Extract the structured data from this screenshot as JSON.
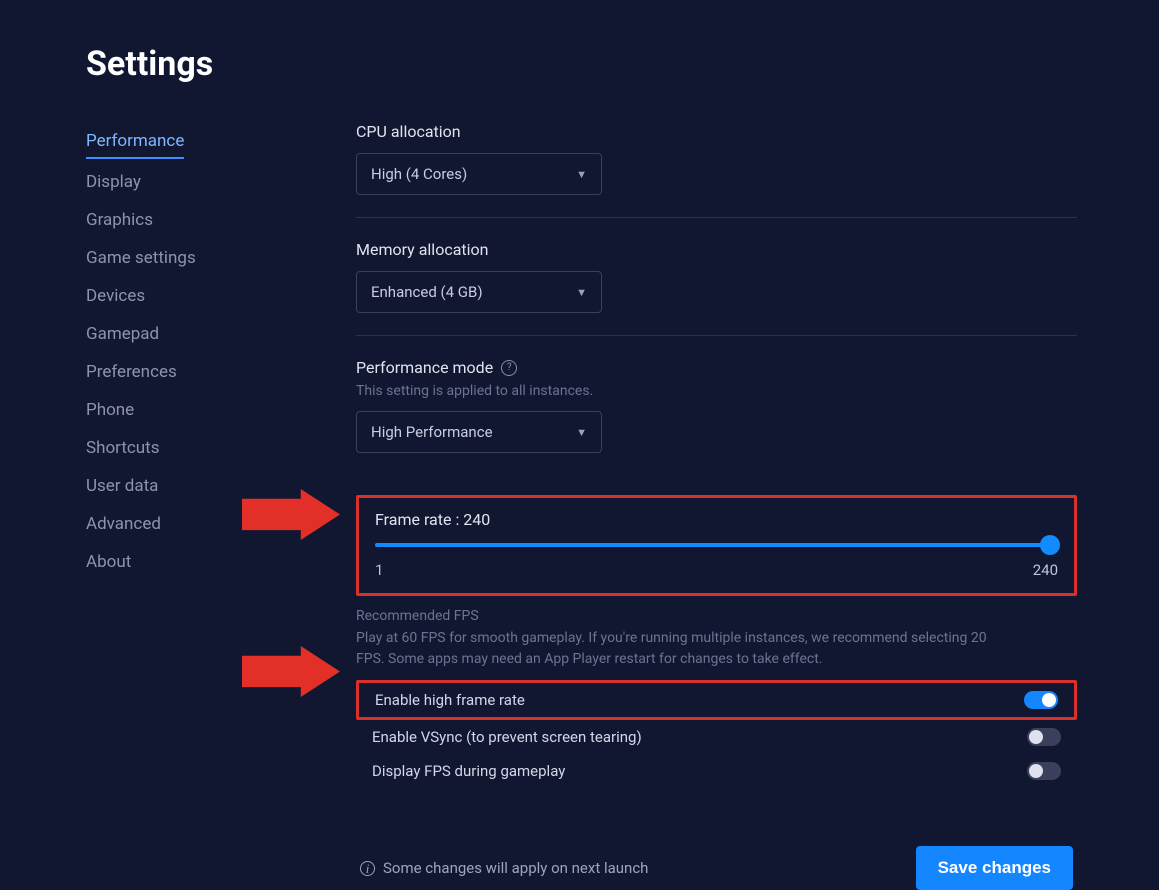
{
  "title": "Settings",
  "sidebar": {
    "items": [
      {
        "label": "Performance",
        "active": true
      },
      {
        "label": "Display"
      },
      {
        "label": "Graphics"
      },
      {
        "label": "Game settings"
      },
      {
        "label": "Devices"
      },
      {
        "label": "Gamepad"
      },
      {
        "label": "Preferences"
      },
      {
        "label": "Phone"
      },
      {
        "label": "Shortcuts"
      },
      {
        "label": "User data"
      },
      {
        "label": "Advanced"
      },
      {
        "label": "About"
      }
    ]
  },
  "cpu": {
    "label": "CPU allocation",
    "value": "High (4 Cores)"
  },
  "memory": {
    "label": "Memory allocation",
    "value": "Enhanced (4 GB)"
  },
  "perf": {
    "label": "Performance mode",
    "sub": "This setting is applied to all instances.",
    "value": "High Performance"
  },
  "frame": {
    "label": "Frame rate : 240",
    "min": "1",
    "max": "240",
    "rec_title": "Recommended FPS",
    "rec_body": "Play at 60 FPS for smooth gameplay. If you're running multiple instances, we recommend selecting 20 FPS. Some apps may need an App Player restart for changes to take effect."
  },
  "toggles": {
    "high_frame": {
      "label": "Enable high frame rate",
      "on": true
    },
    "vsync": {
      "label": "Enable VSync (to prevent screen tearing)",
      "on": false
    },
    "show_fps": {
      "label": "Display FPS during gameplay",
      "on": false
    }
  },
  "footer": {
    "note": "Some changes will apply on next launch",
    "save": "Save changes"
  }
}
